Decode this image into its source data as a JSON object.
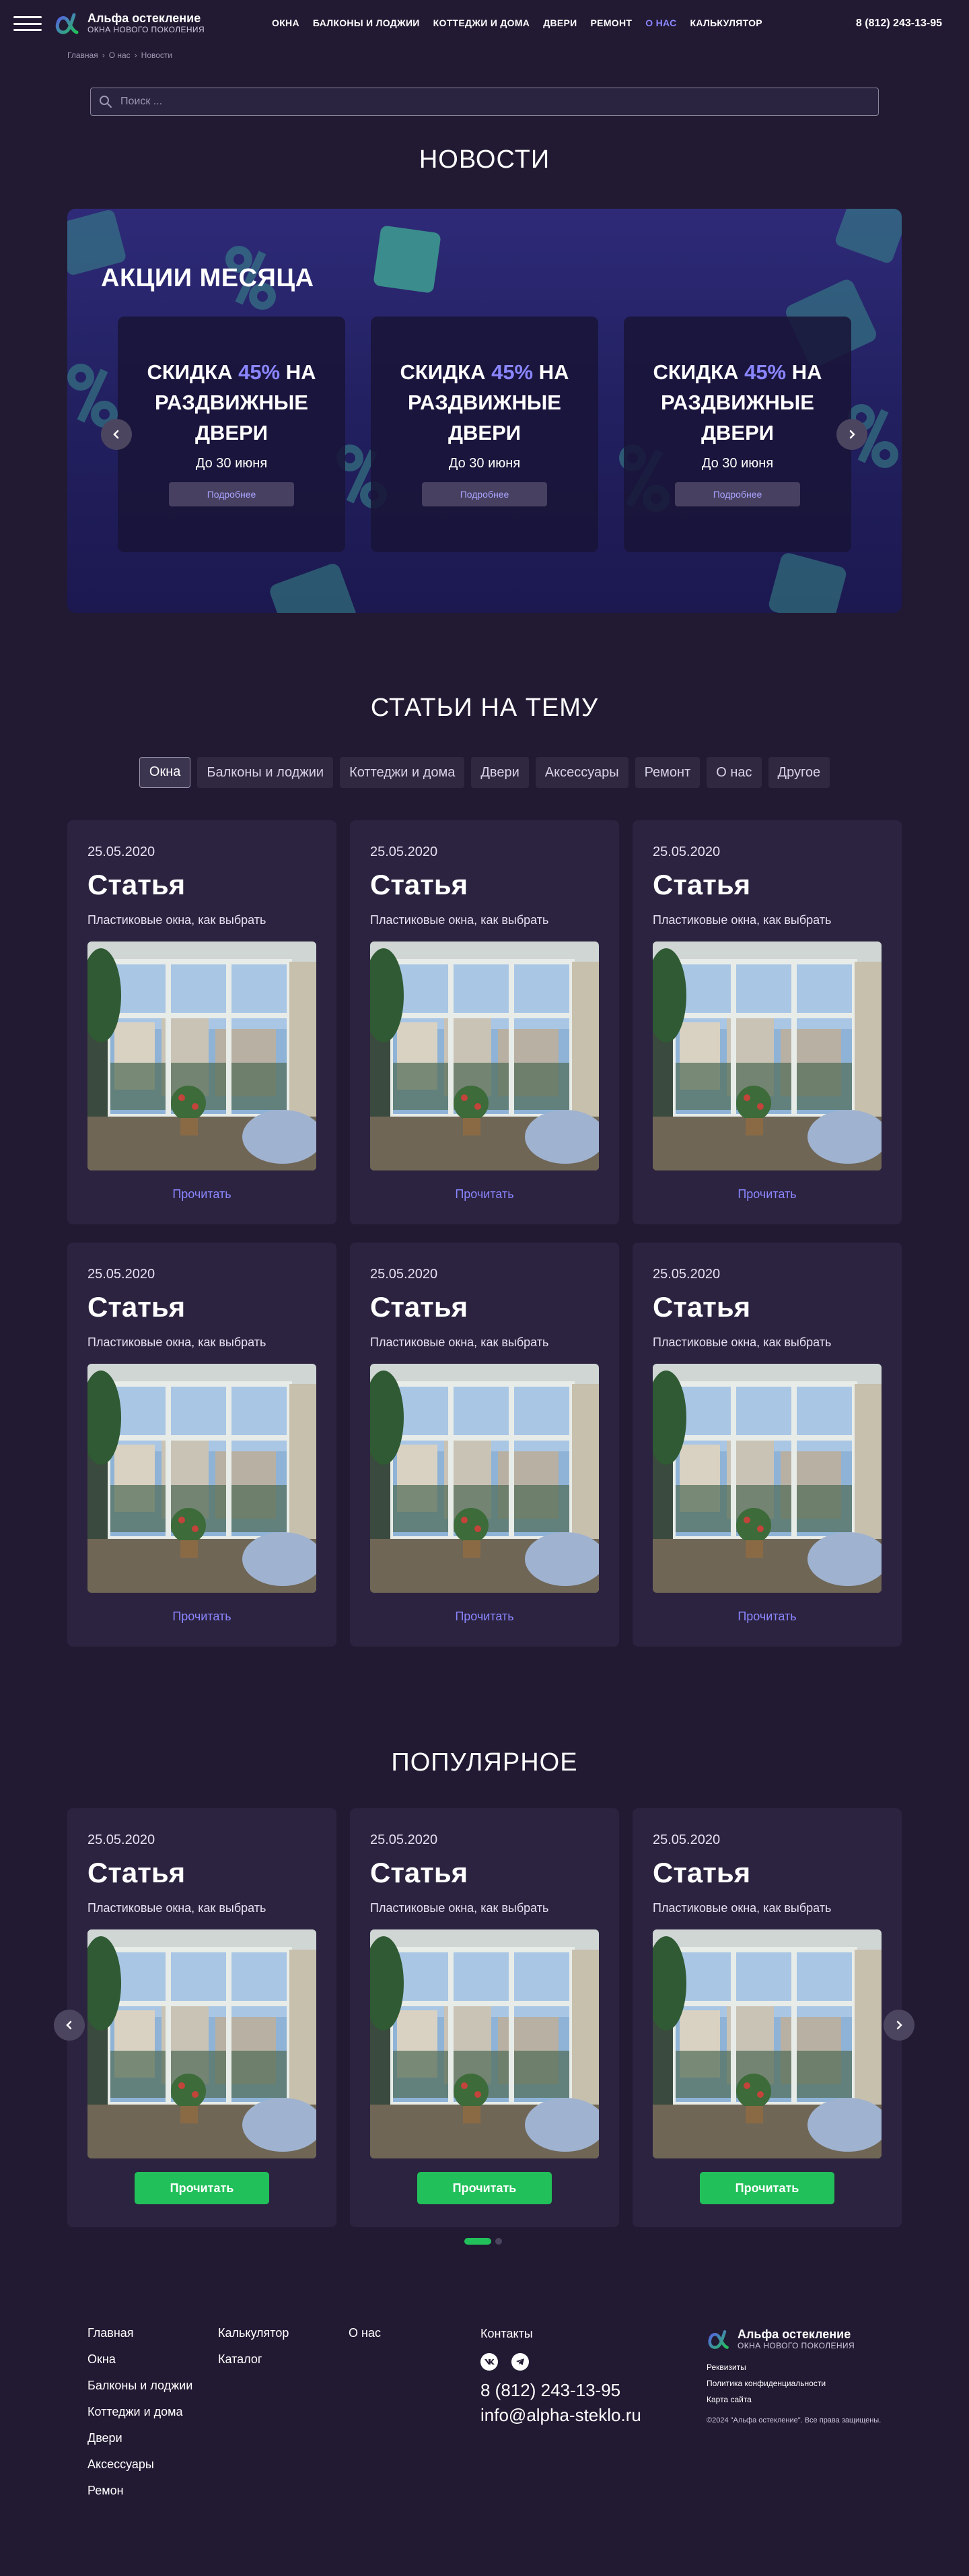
{
  "header": {
    "logo_title": "Альфа остекление",
    "logo_sub": "ОКНА НОВОГО ПОКОЛЕНИЯ",
    "nav": [
      "ОКНА",
      "БАЛКОНЫ И ЛОДЖИИ",
      "КОТТЕДЖИ И ДОМА",
      "ДВЕРИ",
      "РЕМОНТ",
      "О НАС",
      "КАЛЬКУЛЯТОР"
    ],
    "active_nav": "О НАС",
    "phone": "8 (812) 243-13-95"
  },
  "breadcrumb": [
    "Главная",
    "О нас",
    "Новости"
  ],
  "search": {
    "placeholder": "Поиск ..."
  },
  "news": {
    "title": "НОВОСТИ",
    "banner_title": "АКЦИИ МЕСЯЦА",
    "promos": [
      {
        "prefix": "СКИДКА ",
        "percent": "45%",
        "suffix": " НА РАЗДВИЖНЫЕ ДВЕРИ",
        "date": "До 30 июня",
        "button": "Подробнее"
      },
      {
        "prefix": "СКИДКА ",
        "percent": "45%",
        "suffix": " НА РАЗДВИЖНЫЕ ДВЕРИ",
        "date": "До 30 июня",
        "button": "Подробнее"
      },
      {
        "prefix": "СКИДКА ",
        "percent": "45%",
        "suffix": " НА РАЗДВИЖНЫЕ ДВЕРИ",
        "date": "До 30 июня",
        "button": "Подробнее"
      }
    ]
  },
  "articles": {
    "title": "СТАТЬИ НА ТЕМУ",
    "tabs": [
      "Окна",
      "Балконы и лоджии",
      "Коттеджи и дома",
      "Двери",
      "Аксессуары",
      "Ремонт",
      "О нас",
      "Другое"
    ],
    "active_tab": "Окна",
    "items": [
      {
        "date": "25.05.2020",
        "title": "Статья",
        "desc": "Пластиковые окна, как выбрать",
        "link": "Прочитать"
      },
      {
        "date": "25.05.2020",
        "title": "Статья",
        "desc": "Пластиковые окна, как выбрать",
        "link": "Прочитать"
      },
      {
        "date": "25.05.2020",
        "title": "Статья",
        "desc": "Пластиковые окна, как выбрать",
        "link": "Прочитать"
      },
      {
        "date": "25.05.2020",
        "title": "Статья",
        "desc": "Пластиковые окна, как выбрать",
        "link": "Прочитать"
      },
      {
        "date": "25.05.2020",
        "title": "Статья",
        "desc": "Пластиковые окна, как выбрать",
        "link": "Прочитать"
      },
      {
        "date": "25.05.2020",
        "title": "Статья",
        "desc": "Пластиковые окна, как выбрать",
        "link": "Прочитать"
      }
    ]
  },
  "popular": {
    "title": "ПОПУЛЯРНОЕ",
    "items": [
      {
        "date": "25.05.2020",
        "title": "Статья",
        "desc": "Пластиковые окна, как выбрать",
        "button": "Прочитать"
      },
      {
        "date": "25.05.2020",
        "title": "Статья",
        "desc": "Пластиковые окна, как выбрать",
        "button": "Прочитать"
      },
      {
        "date": "25.05.2020",
        "title": "Статья",
        "desc": "Пластиковые окна, как выбрать",
        "button": "Прочитать"
      }
    ]
  },
  "footer": {
    "col1": [
      "Главная",
      "Окна",
      "Балконы и лоджии",
      "Коттеджи и дома",
      "Двери",
      "Аксессуары",
      "Ремон"
    ],
    "col2": [
      "Калькулятор",
      "Каталог"
    ],
    "col3": [
      "О нас"
    ],
    "contacts_heading": "Контакты",
    "phone": "8 (812) 243-13-95",
    "email": "info@alpha-steklo.ru",
    "logo_title": "Альфа остекление",
    "logo_sub": "ОКНА НОВОГО ПОКОЛЕНИЯ",
    "links": [
      "Реквизиты",
      "Политика конфиденциальности",
      "Карта сайта"
    ],
    "copyright": "©2024 \"Альфа остекление\". Все права защищены."
  },
  "colors": {
    "background": "#221a33",
    "accent": "#8a86ff",
    "button_green": "#22c05a",
    "card": "#2c2340"
  }
}
